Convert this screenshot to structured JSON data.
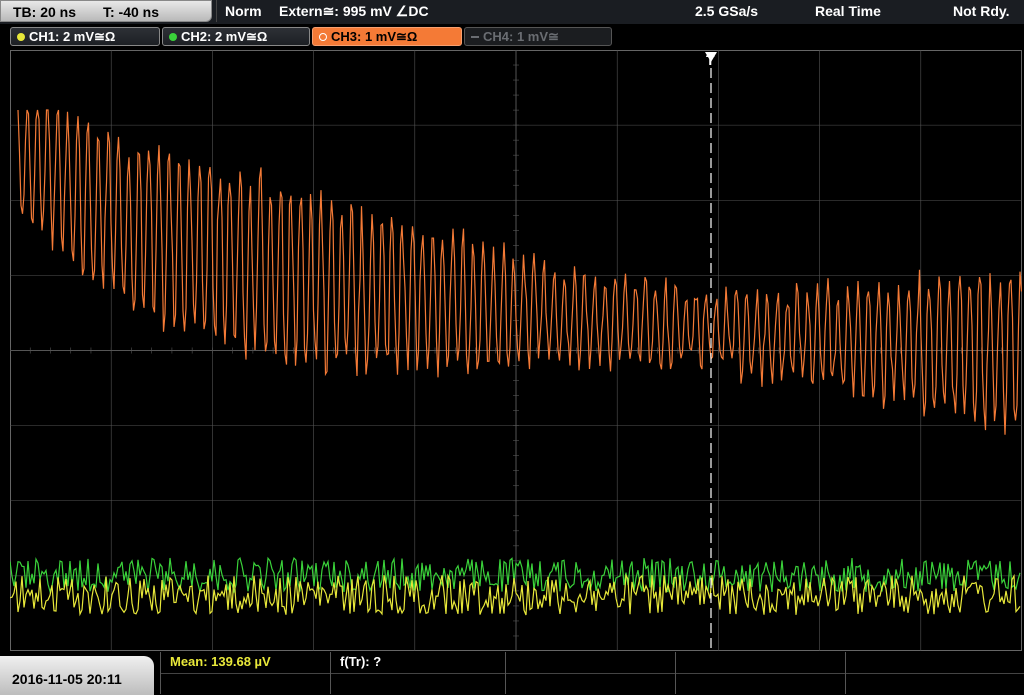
{
  "header": {
    "timebase": "TB: 20 ns",
    "trigger_offset": "T: -40 ns",
    "mode": "Norm",
    "trigger_source": "Extern≅: 995 mV ∠DC",
    "sample_rate": "2.5 GSa/s",
    "acq_mode": "Real Time",
    "status": "Not Rdy."
  },
  "channels": [
    {
      "label": "CH1: 2 mV≅Ω",
      "color": "#e8e83a",
      "state": "on"
    },
    {
      "label": "CH2: 2 mV≅Ω",
      "color": "#3ad23a",
      "state": "on"
    },
    {
      "label": "CH3: 1 mV≅Ω",
      "color": "#f47a36",
      "state": "active"
    },
    {
      "label": "CH4: 1 mV≅",
      "color": "#6a6d72",
      "state": "off"
    }
  ],
  "trigger_marker": "T",
  "footer": {
    "datetime": "2016-11-05 20:11",
    "mean_label": "Mean: 139.68 µV",
    "freq_label": "f(Tr): ?"
  },
  "colors": {
    "ch1": "#e8e83a",
    "ch2": "#3ad23a",
    "ch3": "#f47a36",
    "grid": "#555555",
    "trigger": "#ffffff"
  }
}
